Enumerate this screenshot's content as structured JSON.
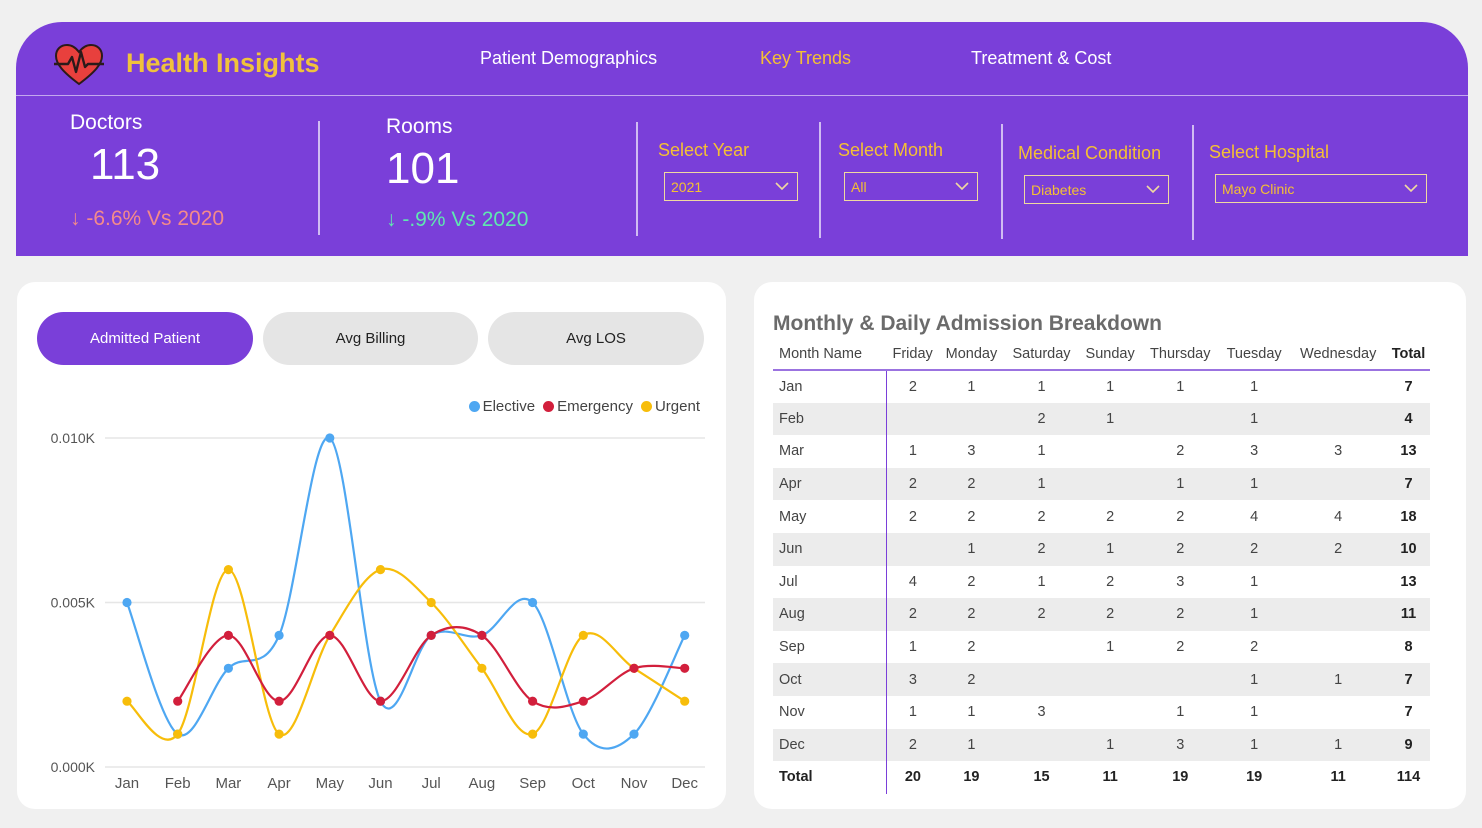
{
  "app": {
    "title": "Health Insights",
    "logo_icon": "heartbeat-icon",
    "nav": [
      {
        "label": "Patient Demographics",
        "active": false
      },
      {
        "label": "Key Trends",
        "active": true
      },
      {
        "label": "Treatment & Cost",
        "active": false
      }
    ]
  },
  "kpis": {
    "doctors": {
      "label": "Doctors",
      "value": "113",
      "change": "↓ -6.6% Vs 2020",
      "color": "#f48a8a"
    },
    "rooms": {
      "label": "Rooms",
      "value": "101",
      "change": "↓ -.9% Vs 2020",
      "color": "#5fe8b0"
    }
  },
  "filters": [
    {
      "label": "Select Year",
      "value": "2021"
    },
    {
      "label": "Select Month",
      "value": "All"
    },
    {
      "label": "Medical Condition",
      "value": "Diabetes"
    },
    {
      "label": "Select Hospital",
      "value": "Mayo Clinic"
    }
  ],
  "chart_tabs": [
    {
      "label": "Admitted Patient",
      "active": true
    },
    {
      "label": "Avg Billing",
      "active": false
    },
    {
      "label": "Avg LOS",
      "active": false
    }
  ],
  "chart_data": {
    "type": "line",
    "categories": [
      "Jan",
      "Feb",
      "Mar",
      "Apr",
      "May",
      "Jun",
      "Jul",
      "Aug",
      "Sep",
      "Oct",
      "Nov",
      "Dec"
    ],
    "y_tick_labels": [
      "0.000K",
      "0.005K",
      "0.010K"
    ],
    "ylim": [
      0,
      10
    ],
    "grid": true,
    "legend_position": "top-right",
    "series": [
      {
        "name": "Elective",
        "color": "#4ea7f2",
        "values": [
          5,
          1,
          3,
          4,
          10,
          2,
          4,
          4,
          5,
          1,
          1,
          4
        ]
      },
      {
        "name": "Emergency",
        "color": "#d21f3c",
        "values": [
          null,
          2,
          4,
          2,
          4,
          2,
          4,
          4,
          2,
          2,
          3,
          3
        ]
      },
      {
        "name": "Urgent",
        "color": "#f7bd0a",
        "values": [
          2,
          1,
          6,
          1,
          4,
          6,
          5,
          3,
          1,
          4,
          3,
          2
        ]
      }
    ]
  },
  "admissions_table": {
    "title": "Monthly & Daily Admission Breakdown",
    "headers": [
      "Month Name",
      "Friday",
      "Monday",
      "Saturday",
      "Sunday",
      "Thursday",
      "Tuesday",
      "Wednesday",
      "Total"
    ],
    "rows": [
      [
        "Jan",
        "2",
        "1",
        "1",
        "1",
        "1",
        "1",
        "",
        "7"
      ],
      [
        "Feb",
        "",
        "",
        "2",
        "1",
        "",
        "1",
        "",
        "4"
      ],
      [
        "Mar",
        "1",
        "3",
        "1",
        "",
        "2",
        "3",
        "3",
        "13"
      ],
      [
        "Apr",
        "2",
        "2",
        "1",
        "",
        "1",
        "1",
        "",
        "7"
      ],
      [
        "May",
        "2",
        "2",
        "2",
        "2",
        "2",
        "4",
        "4",
        "18"
      ],
      [
        "Jun",
        "",
        "1",
        "2",
        "1",
        "2",
        "2",
        "2",
        "10"
      ],
      [
        "Jul",
        "4",
        "2",
        "1",
        "2",
        "3",
        "1",
        "",
        "13"
      ],
      [
        "Aug",
        "2",
        "2",
        "2",
        "2",
        "2",
        "1",
        "",
        "11"
      ],
      [
        "Sep",
        "1",
        "2",
        "",
        "1",
        "2",
        "2",
        "",
        "8"
      ],
      [
        "Oct",
        "3",
        "2",
        "",
        "",
        "",
        "1",
        "1",
        "7"
      ],
      [
        "Nov",
        "1",
        "1",
        "3",
        "",
        "1",
        "1",
        "",
        "7"
      ],
      [
        "Dec",
        "2",
        "1",
        "",
        "1",
        "3",
        "1",
        "1",
        "9"
      ]
    ],
    "totals": [
      "Total",
      "20",
      "19",
      "15",
      "11",
      "19",
      "19",
      "11",
      "114"
    ]
  }
}
